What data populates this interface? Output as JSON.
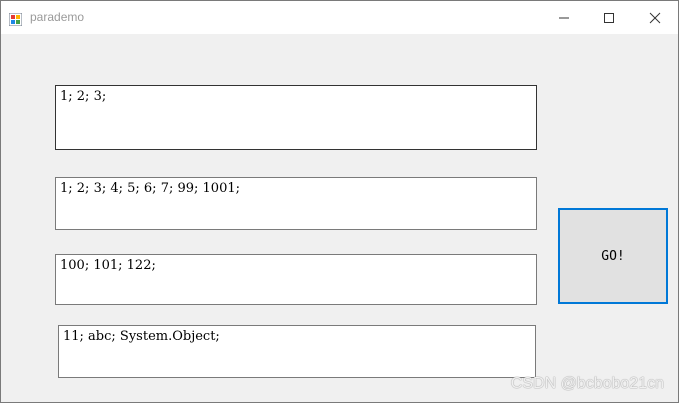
{
  "window": {
    "title": "parademo"
  },
  "textboxes": [
    {
      "value": "1; 2; 3;"
    },
    {
      "value": "1; 2; 3; 4; 5; 6; 7; 99; 1001;"
    },
    {
      "value": "100; 101; 122;"
    },
    {
      "value": "11; abc; System.Object;"
    }
  ],
  "go_button": {
    "label": "GO!"
  },
  "watermark": {
    "text": "CSDN @bcbobo21cn"
  },
  "icons": {
    "app": "app-icon",
    "minimize": "minimize-icon",
    "maximize": "maximize-icon",
    "close": "close-icon"
  },
  "colors": {
    "focus_border": "#0078d7",
    "window_bg": "#f0f0f0"
  }
}
